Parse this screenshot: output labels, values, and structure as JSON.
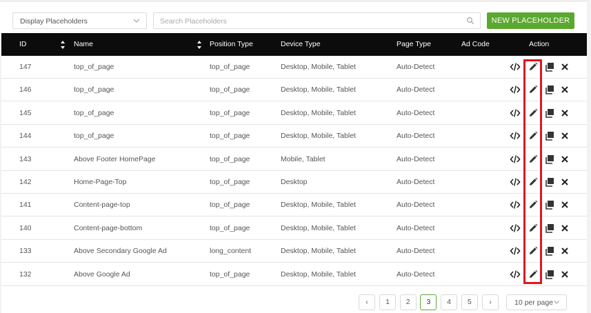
{
  "filters": {
    "display_select": "Display Placeholders",
    "search_placeholder": "Search Placeholders",
    "new_button": "NEW PLACEHOLDER"
  },
  "table": {
    "headers": {
      "id": "ID",
      "name": "Name",
      "position_type": "Position Type",
      "device_type": "Device Type",
      "page_type": "Page Type",
      "ad_code": "Ad Code",
      "action": "Action"
    },
    "rows": [
      {
        "id": "147",
        "name": "top_of_page",
        "position_type": "top_of_page",
        "device_type": "Desktop, Mobile, Tablet",
        "page_type": "Auto-Detect"
      },
      {
        "id": "146",
        "name": "top_of_page",
        "position_type": "top_of_page",
        "device_type": "Desktop, Mobile, Tablet",
        "page_type": "Auto-Detect"
      },
      {
        "id": "145",
        "name": "top_of_page",
        "position_type": "top_of_page",
        "device_type": "Desktop, Mobile, Tablet",
        "page_type": "Auto-Detect"
      },
      {
        "id": "144",
        "name": "top_of_page",
        "position_type": "top_of_page",
        "device_type": "Desktop, Mobile, Tablet",
        "page_type": "Auto-Detect"
      },
      {
        "id": "143",
        "name": "Above Footer HomePage",
        "position_type": "top_of_page",
        "device_type": "Mobile, Tablet",
        "page_type": "Auto-Detect"
      },
      {
        "id": "142",
        "name": "Home-Page-Top",
        "position_type": "top_of_page",
        "device_type": "Desktop",
        "page_type": "Auto-Detect"
      },
      {
        "id": "141",
        "name": "Content-page-top",
        "position_type": "top_of_page",
        "device_type": "Desktop, Mobile, Tablet",
        "page_type": "Auto-Detect"
      },
      {
        "id": "140",
        "name": "Content-page-bottom",
        "position_type": "top_of_page",
        "device_type": "Desktop, Mobile, Tablet",
        "page_type": "Auto-Detect"
      },
      {
        "id": "133",
        "name": "Above Secondary Google Ad",
        "position_type": "long_content",
        "device_type": "Desktop, Mobile, Tablet",
        "page_type": "Auto-Detect"
      },
      {
        "id": "132",
        "name": "Above Google Ad",
        "position_type": "top_of_page",
        "device_type": "Desktop, Mobile, Tablet",
        "page_type": "Auto-Detect"
      }
    ],
    "row_actions": [
      "code-icon",
      "edit-pencil-icon",
      "duplicate-icon",
      "delete-x-icon"
    ]
  },
  "pagination": {
    "prev": "‹",
    "pages": [
      "1",
      "2",
      "3",
      "4",
      "5"
    ],
    "current": "3",
    "next": "›",
    "per_page": "10 per page"
  },
  "colors": {
    "accent_green": "#5aa82e",
    "header_bg": "#0c0c0c",
    "highlight_red": "#e0161e"
  }
}
